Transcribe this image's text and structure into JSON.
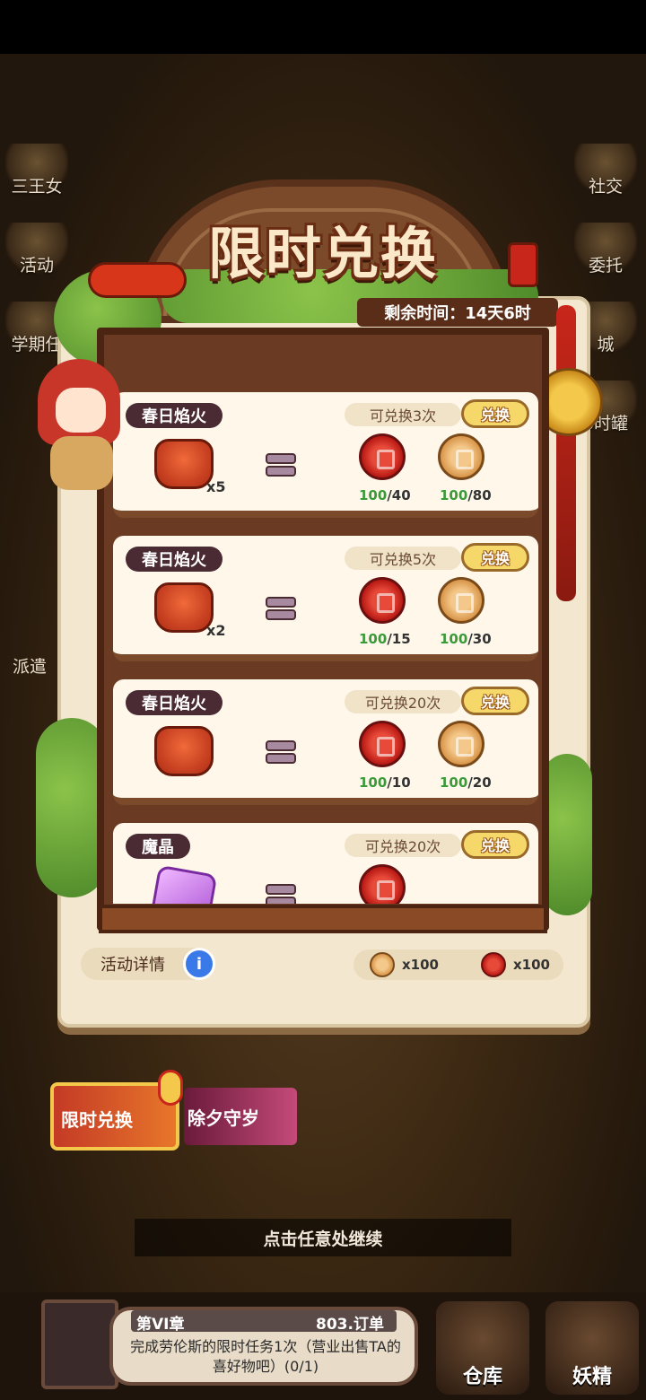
{
  "side_left": [
    "三王女",
    "活动",
    "学期任"
  ],
  "side_right": [
    "社交",
    "委托",
    "城",
    "6时罐"
  ],
  "left_extra": "派遣",
  "title": "限时兑换",
  "timer": "剩余时间：14天6时",
  "cards": [
    {
      "name": "春日焰火",
      "limit": "可兑换3次",
      "btn": "兑换",
      "qty": "x5",
      "red_have": "100",
      "red_need": "/40",
      "gold_have": "100",
      "gold_need": "/80"
    },
    {
      "name": "春日焰火",
      "limit": "可兑换5次",
      "btn": "兑换",
      "qty": "x2",
      "red_have": "100",
      "red_need": "/15",
      "gold_have": "100",
      "gold_need": "/30"
    },
    {
      "name": "春日焰火",
      "limit": "可兑换20次",
      "btn": "兑换",
      "qty": "",
      "red_have": "100",
      "red_need": "/10",
      "gold_have": "100",
      "gold_need": "/20"
    },
    {
      "name": "魔晶",
      "limit": "可兑换20次",
      "btn": "兑换",
      "qty": "",
      "red_have": "",
      "red_need": "",
      "gold_have": "",
      "gold_need": ""
    }
  ],
  "details_label": "活动详情",
  "info_icon_glyph": "i",
  "wallet": {
    "gold": "x100",
    "red": "x100"
  },
  "tabs": {
    "tab1": "限时兑换",
    "tab2": "除夕守岁"
  },
  "continue_text": "点击任意处继续",
  "quest": {
    "chapter": "第VI章",
    "orders": "803.订单",
    "text": "完成劳伦斯的限时任务1次（营业出售TA的喜好物吧）(0/1)"
  },
  "bottom_buttons": {
    "store": "仓库",
    "fairy": "妖精"
  },
  "colors": {
    "accent_red": "#c8261a",
    "gold": "#f6d86a",
    "panel": "#f3e7cf",
    "shelf": "#6b3a22"
  }
}
